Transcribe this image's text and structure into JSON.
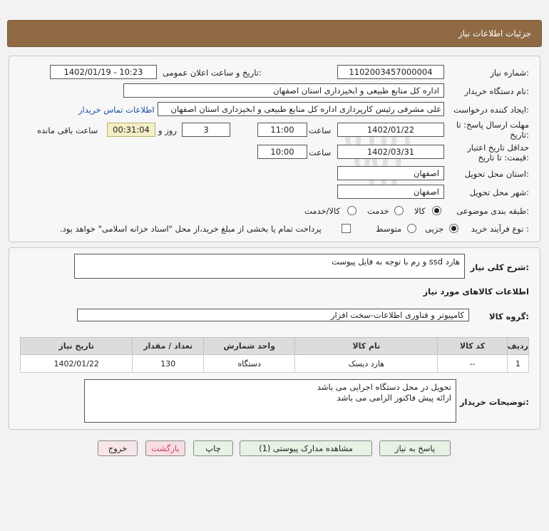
{
  "header": {
    "title": "جزئیات اطلاعات نیاز"
  },
  "fields": {
    "need_number_label": "شماره نیاز:",
    "need_number": "1102003457000004",
    "announce_label": "تاریخ و ساعت اعلان عمومی:",
    "announce_value": "1402/01/19 - 10:23",
    "buyer_label": "نام دستگاه خریدار:",
    "buyer_value": "اداره کل منابع طبیعی و ابخیزداری استان اصفهان",
    "creator_label": "ایجاد کننده درخواست:",
    "creator_value": "علی مشرفی رئیس کارپردازی اداره کل منابع طبیعی و ابخیزداری استان اصفهان",
    "contact_link": "اطلاعات تماس خریدار",
    "deadline_label_1": "مهلت ارسال پاسخ: تا",
    "deadline_label_2": "تاریخ:",
    "deadline_date": "1402/01/22",
    "time_label": "ساعت",
    "deadline_time": "11:00",
    "days_value": "3",
    "days_label": "روز و",
    "remaining_value": "00:31:04",
    "remaining_label": "ساعت باقی مانده",
    "validity_label_1": "حداقل تاریخ اعتبار",
    "validity_label_2": "قیمت: تا تاریخ:",
    "validity_date": "1402/03/31",
    "validity_time_label": "ساعت",
    "validity_time": "10:00",
    "province_label": "استان محل تحویل:",
    "province_value": "اصفهان",
    "city_label": "شهر محل تحویل:",
    "city_value": "اصفهان",
    "category_label": "طبقه بندی موضوعی:",
    "category_options": [
      "کالا",
      "خدمت",
      "کالا/خدمت"
    ],
    "process_label": "نوع فرآیند خرید :",
    "process_options": [
      "جزیی",
      "متوسط"
    ],
    "payment_note": "پرداخت تمام یا بخشی از مبلغ خرید،از محل \"اسناد خزانه اسلامی\" خواهد بود."
  },
  "summary": {
    "title_label": "شرح کلی نیاز:",
    "title_value": "هارد ssd و رم با توجه به فایل پیوست",
    "goods_info_label": "اطلاعات کالاهای مورد نیاز",
    "goods_group_label": "گروه کالا:",
    "goods_group_value": "کامپیوتر و فناوری اطلاعات-سخت افزار"
  },
  "table": {
    "headers": [
      "ردیف",
      "کد کالا",
      "نام کالا",
      "واحد شمارش",
      "تعداد / مقدار",
      "تاریخ نیاز"
    ],
    "rows": [
      [
        "1",
        "--",
        "هارد دیسک",
        "دستگاه",
        "130",
        "1402/01/22"
      ]
    ]
  },
  "buyer_notes": {
    "label": "توضیحات خریدار:",
    "line1": "تحویل در محل دستگاه اجرایی می باشد",
    "line2": "ارائه پیش فاکتور الزامی می باشد"
  },
  "buttons": {
    "reply": "پاسخ به نیاز",
    "attachments": "مشاهده مدارک پیوستی (1)",
    "print": "چاپ",
    "back": "بازگشت",
    "exit": "خروج"
  },
  "watermark": {
    "brand": "ParsNamadData",
    "line1": "پایگاه اطلاع رسانی مناقصه و مزایده",
    "phone": "۰۲۱-۸۸۳۴۹۶۷۰-۵",
    "top_digits": "0101\n001\n10"
  }
}
